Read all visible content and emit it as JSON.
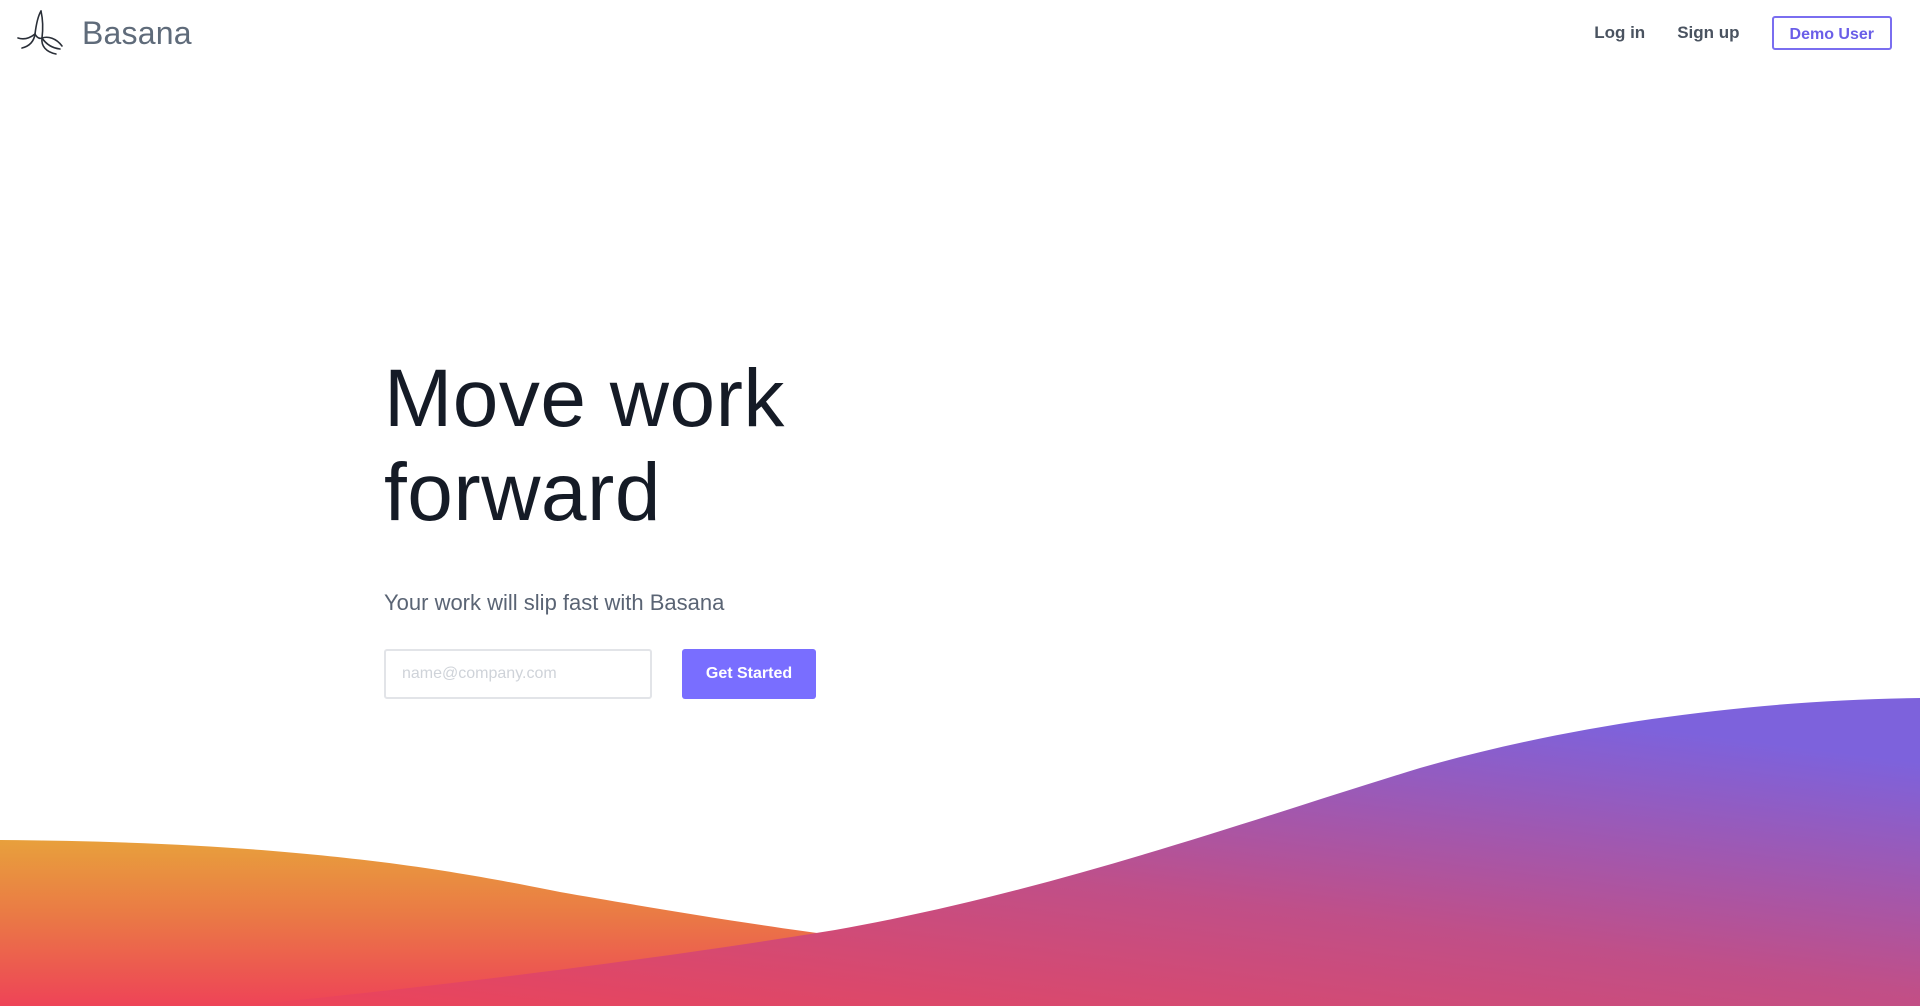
{
  "header": {
    "brand": "Basana",
    "nav": {
      "login_label": "Log in",
      "signup_label": "Sign up",
      "demo_label": "Demo User"
    }
  },
  "hero": {
    "title_line1": "Move work",
    "title_line2": "forward",
    "subtitle": "Your work will slip fast with Basana",
    "email_placeholder": "name@company.com",
    "cta_label": "Get Started"
  },
  "colors": {
    "accent": "#796eff",
    "wave_orange": "#e8a03c",
    "wave_red": "#ee4357",
    "wave_purple": "#7d62dc",
    "title_text": "#151b26"
  }
}
